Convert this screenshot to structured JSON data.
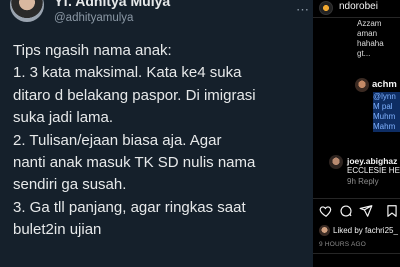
{
  "tweet": {
    "display_name": "Yf. Adhitya Mulya",
    "handle": "@adhityamulya",
    "lines": [
      "Tips ngasih nama anak:",
      "1. 3 kata maksimal. Kata ke4 suka",
      "ditaro d belakang paspor. Di imigrasi",
      "suka jadi lama.",
      "2. Tulisan/ejaan biasa aja. Agar",
      "nanti anak masuk TK SD nulis nama",
      "sendiri ga susah.",
      "3. Ga tll panjang, agar ringkas saat",
      "bulet2in ujian"
    ]
  },
  "instagram": {
    "username": "ndorobei",
    "comment_lines": [
      "Azzam",
      "aman",
      "hahaha",
      "gt..."
    ],
    "reply": {
      "username": "achm",
      "lines": [
        "@lynn",
        "M pal",
        "Muhm",
        "Mahm"
      ]
    },
    "comment2": {
      "username": "joey.abighaz",
      "text": "ECCLESIE HEC",
      "sub": "9h  Reply"
    },
    "liked_by": "Liked by fachri25_",
    "timestamp": "9 HOURS AGO",
    "icons": {
      "like": "heart-icon",
      "comment": "comment-icon",
      "share": "paper-plane-icon",
      "save": "bookmark-icon"
    }
  }
}
